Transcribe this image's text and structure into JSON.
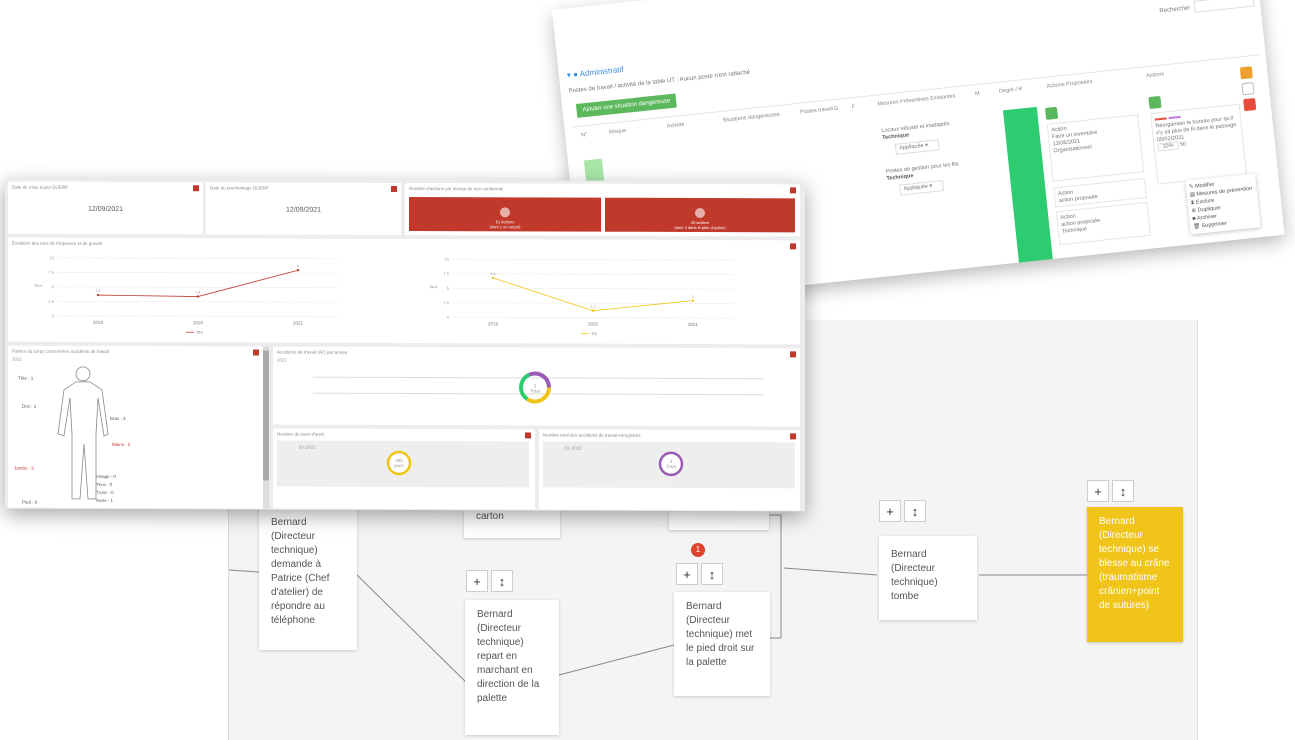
{
  "tree": {
    "nodes": [
      {
        "id": "n1",
        "text": "Bernard (Directeur technique) demande à Patrice (Chef d'atelier) de répondre au téléphone"
      },
      {
        "id": "n2",
        "text": "carton"
      },
      {
        "id": "n3",
        "text": "Bernard (Directeur technique) repart en marchant en direction de la palette"
      },
      {
        "id": "n4",
        "text": "Bernard (Directeur technique) met le pied droit sur la palette"
      },
      {
        "id": "n5",
        "text": "Bernard (Directeur technique) tombe"
      },
      {
        "id": "n6",
        "text": "Bernard (Directeur technique) se blesse au crâne (traumatisme crânien+point de sutures)"
      }
    ],
    "add_label": "+",
    "move_label": "↕",
    "badge": "1",
    "colors": {
      "highlight": "#f0c419",
      "badge": "#e0442e"
    }
  },
  "risk": {
    "section_title": "Administratif",
    "subtitle": "Postes de travail / activité de la table UT : Aucun poste n'est rattaché",
    "add_button": "Ajouter une situation dangereuse",
    "search_label": "Rechercher",
    "columns": [
      "N°",
      "Risque",
      "Activité",
      "Situations dangereuses",
      "Postes travail",
      "G",
      "F",
      "Mesures Préventives Existantes",
      "M",
      "Degré / R",
      "Actions Proposées",
      "Actions"
    ],
    "measure1_title": "Locaux vétuste et inadaptés",
    "measure1_type": "Technique",
    "measure1_status": "Appliquée",
    "measure2_title": "Postes de gestion pour les fils",
    "measure2_type": "Technique",
    "measure2_status": "Appliquée",
    "card1": {
      "label": "Action",
      "title": "Faire un inventaire",
      "date": "13/08/2021",
      "type": "Organisationnel"
    },
    "card2": {
      "label": "Action",
      "title": "action proposée"
    },
    "card3": {
      "label": "Action",
      "title": "action proposée",
      "type": "Technique"
    },
    "action1": {
      "title": "Réorganiser le bureau pour qu'il n'y ait plus de fil dans le passage",
      "date": "05/02/2021",
      "progress": "10%",
      "qty": "50"
    },
    "menu": [
      "Modifier",
      "Mesures de prévention",
      "Exclure",
      "Dupliquer",
      "Archiver",
      "Supprimer"
    ],
    "colors": {
      "green": "#2ecc71",
      "add": "#5cb85c",
      "edit": "#f0a030",
      "delete": "#e74c3c"
    }
  },
  "dash": {
    "panel1_title": "Date de mise à jour DUERP",
    "panel1_value": "12/09/2021",
    "panel2_title": "Date du prochainage DUERP",
    "panel2_value": "12/09/2021",
    "panel3_title": "Nombre d'actions par niveau de non conformité",
    "box1_label": "61 Actions",
    "box1_sub": "(dont 1 en retard)",
    "box2_label": "25 actions",
    "box2_sub": "(dont 4 dans le plan d'action)",
    "chart_title": "Évolution des taux de fréquence et de gravité",
    "body_title": "Parties du corps concernées accidents de travail",
    "body_year": "2021",
    "body_labels": [
      "Tête : 1",
      "Dos : 3",
      "Bras : 3",
      "Mains : 2",
      "Jambe : 3",
      "Visage : 0",
      "Yeux : 0",
      "Tronc : 0",
      "Pied : 0",
      "Autre : 1"
    ],
    "at_title": "Accidents de travail (AT) par année",
    "at_year": "2021",
    "at_center": "2",
    "at_center_sub": "Total",
    "days_title": "Nombre de jours d'arrêt",
    "days_center": "365",
    "days_center_sub": "jours",
    "days_year": "En 2021",
    "mp_title": "Nombre total des accidents de travail enregistrés",
    "mp_center": "3",
    "mp_center_sub": "Total",
    "mp_year": "En 2021"
  },
  "chart_data": [
    {
      "type": "line",
      "title": "Évolution des taux de fréquence et de gravité",
      "x": [
        "2019",
        "2020",
        "2021"
      ],
      "series": [
        {
          "name": "TF1",
          "values": [
            3.6,
            3.4,
            8.0
          ],
          "color": "#c0392b"
        }
      ],
      "ylabel": "Taux",
      "ylim": [
        0,
        10
      ]
    },
    {
      "type": "line",
      "x": [
        "2019",
        "2020",
        "2021"
      ],
      "series": [
        {
          "name": "TG",
          "values": [
            6.8,
            1.2,
            3.0
          ],
          "color": "#f0c419"
        }
      ],
      "ylabel": "Taux",
      "ylim": [
        0,
        10
      ]
    }
  ]
}
